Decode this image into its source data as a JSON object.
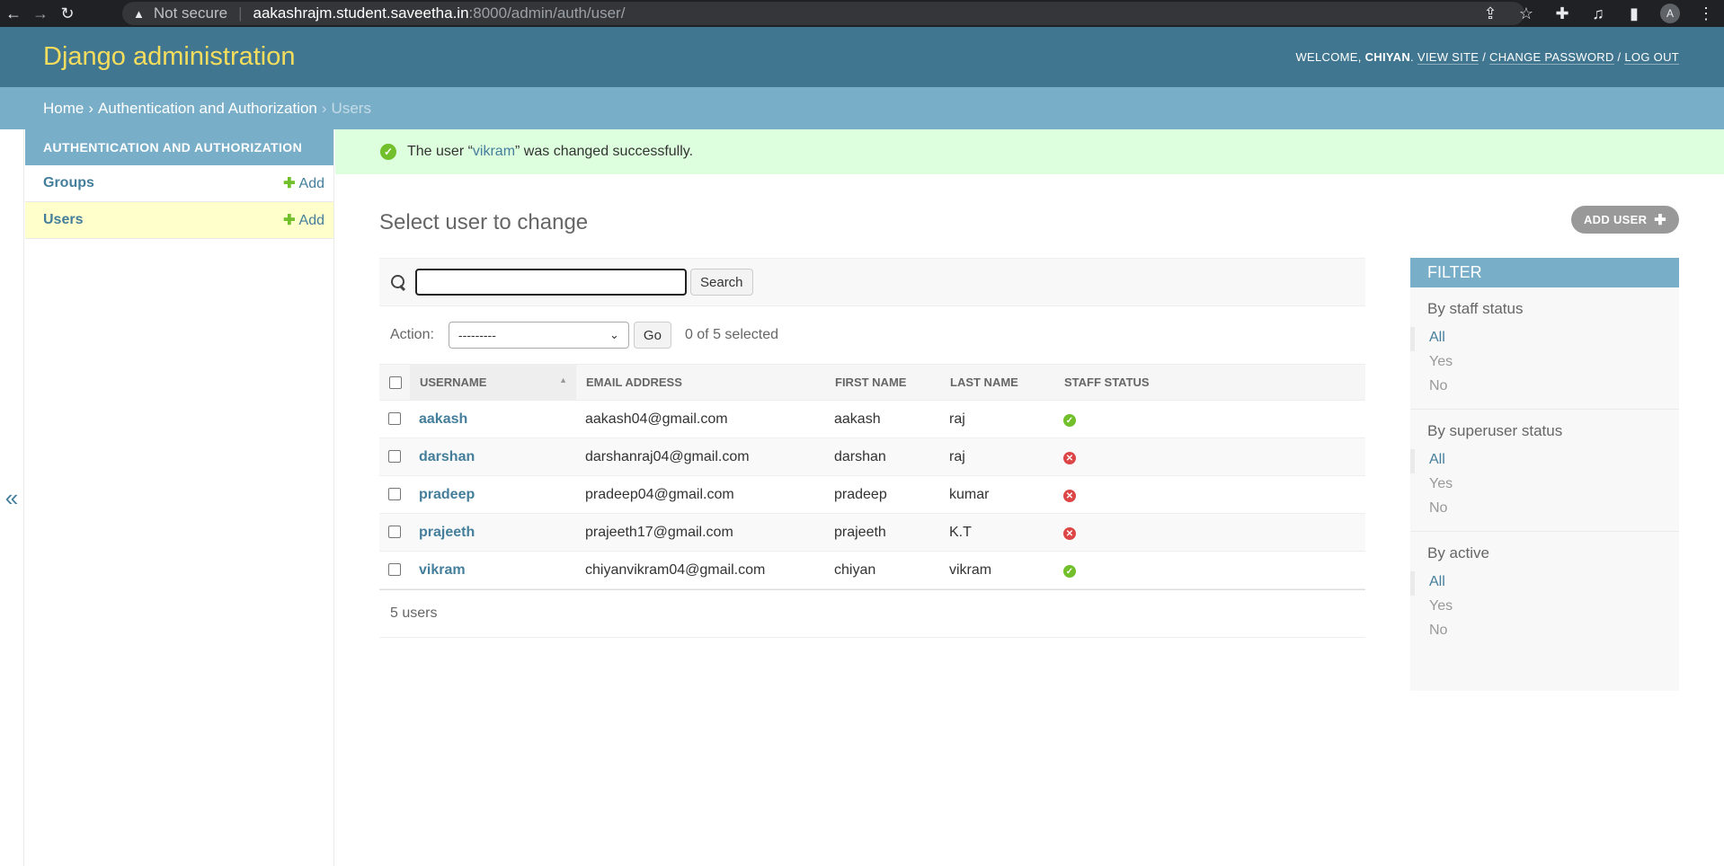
{
  "browser": {
    "not_secure": "Not secure",
    "url_host": "aakashrajm.student.saveetha.in",
    "url_path": ":8000/admin/auth/user/",
    "profile_initial": "A"
  },
  "header": {
    "brand": "Django administration",
    "welcome": "Welcome,",
    "username": "chiyan",
    "view_site": "View site",
    "change_password": "Change password",
    "log_out": "Log out"
  },
  "breadcrumbs": {
    "home": "Home",
    "app": "Authentication and Authorization",
    "current": "Users"
  },
  "nav": {
    "caption": "Authentication and Authorization",
    "toggle": "«",
    "items": [
      {
        "label": "Groups",
        "add": "Add"
      },
      {
        "label": "Users",
        "add": "Add"
      }
    ]
  },
  "message": {
    "before": "The user “",
    "link": "vikram",
    "after": "” was changed successfully."
  },
  "page": {
    "title": "Select user to change",
    "add_button": "Add user"
  },
  "search": {
    "button": "Search",
    "value": ""
  },
  "actions": {
    "label": "Action:",
    "selected": "---------",
    "go": "Go",
    "count": "0 of 5 selected"
  },
  "table": {
    "headers": [
      "Username",
      "Email address",
      "First name",
      "Last name",
      "Staff status"
    ],
    "rows": [
      {
        "username": "aakash",
        "email": "aakash04@gmail.com",
        "first": "aakash",
        "last": "raj",
        "staff": true
      },
      {
        "username": "darshan",
        "email": "darshanraj04@gmail.com",
        "first": "darshan",
        "last": "raj",
        "staff": false
      },
      {
        "username": "pradeep",
        "email": "pradeep04@gmail.com",
        "first": "pradeep",
        "last": "kumar",
        "staff": false
      },
      {
        "username": "prajeeth",
        "email": "prajeeth17@gmail.com",
        "first": "prajeeth",
        "last": "K.T",
        "staff": false
      },
      {
        "username": "vikram",
        "email": "chiyanvikram04@gmail.com",
        "first": "chiyan",
        "last": "vikram",
        "staff": true
      }
    ]
  },
  "paginator": "5 users",
  "filter": {
    "caption": "Filter",
    "groups": [
      {
        "title": "By staff status",
        "options": [
          "All",
          "Yes",
          "No"
        ],
        "selected": 0
      },
      {
        "title": "By superuser status",
        "options": [
          "All",
          "Yes",
          "No"
        ],
        "selected": 0
      },
      {
        "title": "By active",
        "options": [
          "All",
          "Yes",
          "No"
        ],
        "selected": 0
      }
    ]
  },
  "colors": {
    "header_bg": "#417690",
    "breadcrumb_bg": "#79aec8",
    "brand_yellow": "#f5dd5d",
    "link": "#447e9b",
    "success_bg": "#ddffdd",
    "yes_icon": "#70bf2b",
    "no_icon": "#dd4646"
  }
}
